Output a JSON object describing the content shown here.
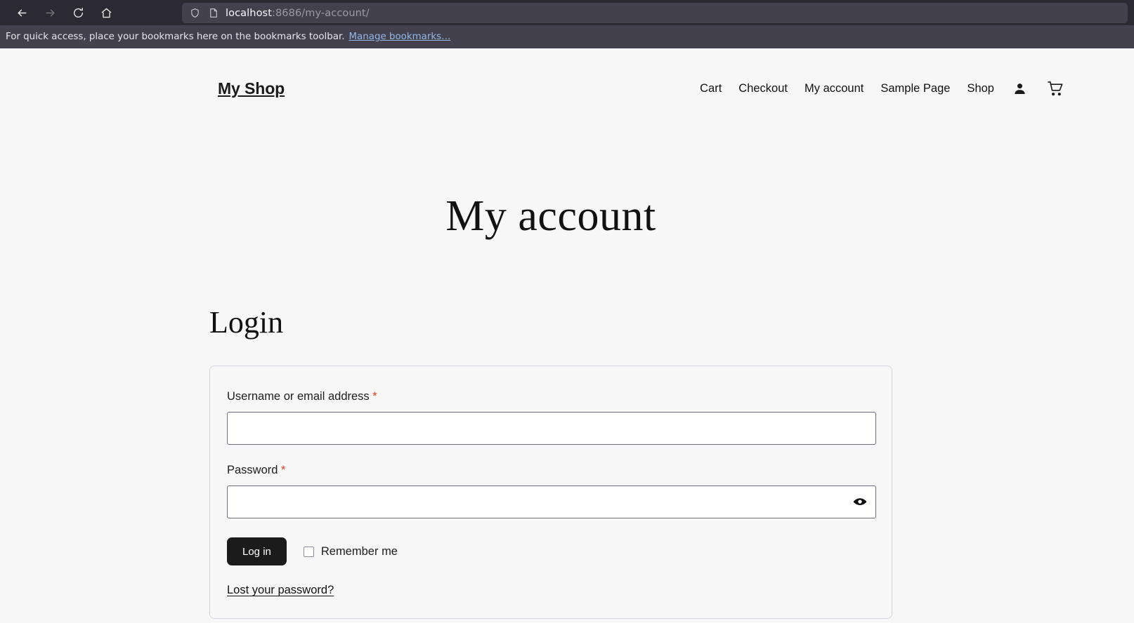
{
  "browser": {
    "back_icon": "back-arrow-icon",
    "forward_icon": "forward-arrow-icon",
    "reload_icon": "reload-icon",
    "home_icon": "home-icon",
    "shield_icon": "shield-icon",
    "page_icon": "page-document-icon",
    "url_host": "localhost",
    "url_path": ":8686/my-account/",
    "bookmarks_message": "For quick access, place your bookmarks here on the bookmarks toolbar.",
    "bookmarks_link": "Manage bookmarks…",
    "chrome_bg": "#2b2a33",
    "bookmarks_bg": "#42414d",
    "link_color": "#93b7e8"
  },
  "site": {
    "brand": "My Shop",
    "nav": [
      {
        "label": "Cart"
      },
      {
        "label": "Checkout"
      },
      {
        "label": "My account"
      },
      {
        "label": "Sample Page"
      },
      {
        "label": "Shop"
      }
    ],
    "account_icon": "person-icon",
    "cart_icon": "shopping-cart-icon",
    "page_bg": "#f7f7f7"
  },
  "main": {
    "page_title": "My account",
    "login_heading": "Login",
    "form": {
      "username_label": "Username or email address",
      "username_required": "*",
      "username_value": "",
      "password_label": "Password",
      "password_required": "*",
      "password_value": "",
      "password_toggle_icon": "eye-icon",
      "submit_label": "Log in",
      "remember_label": "Remember me",
      "remember_checked": false,
      "lost_password_label": "Lost your password?",
      "required_color": "#e2401c",
      "button_bg": "#1b1b1b"
    }
  }
}
